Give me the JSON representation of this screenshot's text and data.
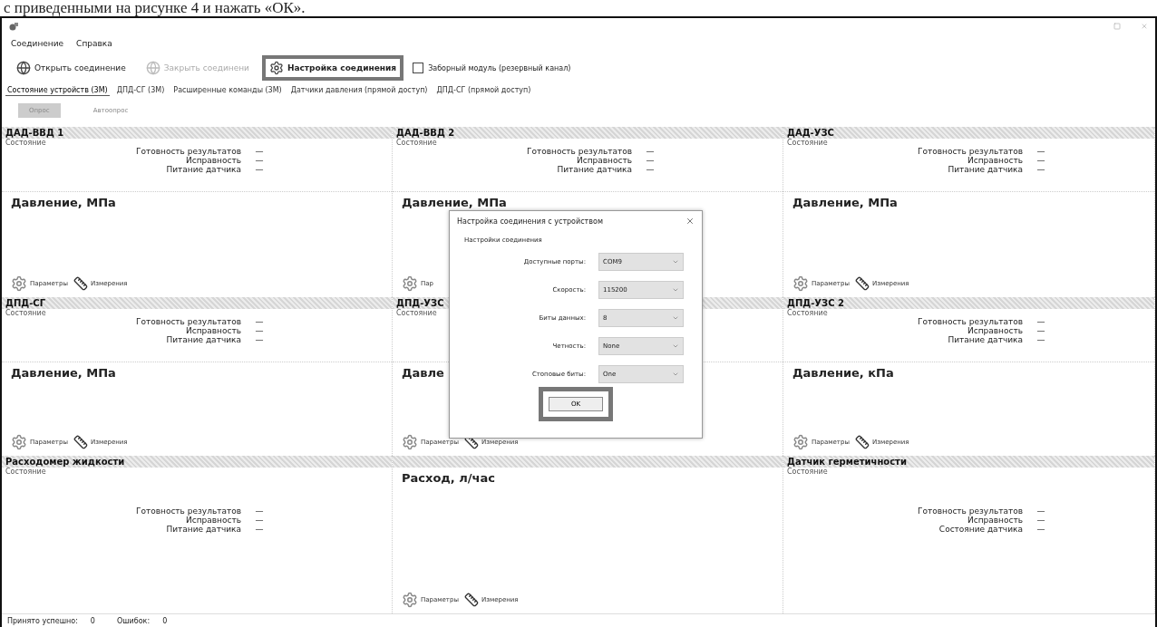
{
  "caption": "с приведенными на рисунке 4 и нажать «ОК».",
  "menu": [
    {
      "label": "Соединение"
    },
    {
      "label": "Справка"
    }
  ],
  "toolbar": [
    {
      "kind": "button",
      "label": "Открыть соединение",
      "disabled": false,
      "highlighted": false
    },
    {
      "kind": "button",
      "label": "Закрыть соединени",
      "disabled": true,
      "highlighted": false
    },
    {
      "kind": "button",
      "label": "Настройка соединения",
      "disabled": false,
      "highlighted": true
    },
    {
      "kind": "checkbox",
      "label": "Заборный модуль (резервный канал)",
      "checked": false
    }
  ],
  "tabs": [
    {
      "label": "Состояние устройств (3М)",
      "selected": true
    },
    {
      "label": "ДПД-СГ (3М)",
      "selected": false
    },
    {
      "label": "Расширенные команды (3М)",
      "selected": false
    },
    {
      "label": "Датчики давления (прямой доступ)",
      "selected": false
    },
    {
      "label": "ДПД-СГ (прямой доступ)",
      "selected": false
    }
  ],
  "poll_buttons": [
    {
      "label": "Опрос",
      "kind": "raised"
    },
    {
      "label": "Автоопрос",
      "kind": "flat"
    }
  ],
  "panels": [
    {
      "title": "ДАД-ВВД 1",
      "state_label": "Состояние",
      "status": [
        {
          "label": "Готовность результатов",
          "value": "—"
        },
        {
          "label": "Исправность",
          "value": "—"
        },
        {
          "label": "Питание датчика",
          "value": "—"
        }
      ],
      "measure": "Давление, МПа",
      "actions": [
        {
          "label": "Параметры",
          "kind": "gear"
        },
        {
          "label": "Измерения",
          "kind": "ruler"
        }
      ]
    },
    {
      "title": "ДАД-ВВД 2",
      "state_label": "Состояние",
      "status": [
        {
          "label": "Готовность результатов",
          "value": "—"
        },
        {
          "label": "Исправность",
          "value": "—"
        },
        {
          "label": "Питание датчика",
          "value": "—"
        }
      ],
      "measure": "Давление, МПа",
      "actions": [
        {
          "label": "Пар",
          "kind": "gear"
        }
      ]
    },
    {
      "title": "ДАД-УЗС",
      "state_label": "Состояние",
      "status": [
        {
          "label": "Готовность результатов",
          "value": "—"
        },
        {
          "label": "Исправность",
          "value": "—"
        },
        {
          "label": "Питание датчика",
          "value": "—"
        }
      ],
      "measure": "Давление, МПа",
      "actions": [
        {
          "label": "Параметры",
          "kind": "gear"
        },
        {
          "label": "Измерения",
          "kind": "ruler"
        }
      ]
    },
    {
      "title": "ДПД-СГ",
      "state_label": "Состояние",
      "status": [
        {
          "label": "Готовность результатов",
          "value": "—"
        },
        {
          "label": "Исправность",
          "value": "—"
        },
        {
          "label": "Питание датчика",
          "value": "—"
        }
      ],
      "measure": "Давление, МПа",
      "actions": [
        {
          "label": "Параметры",
          "kind": "gear"
        },
        {
          "label": "Измерения",
          "kind": "ruler"
        }
      ]
    },
    {
      "title": "ДПД-УЗС",
      "state_label": "Состояние",
      "measure": "Давле",
      "actions": [
        {
          "label": "Параметры",
          "kind": "gear"
        },
        {
          "label": "Измерения",
          "kind": "ruler"
        }
      ]
    },
    {
      "title": "ДПД-УЗС 2",
      "state_label": "Состояние",
      "status": [
        {
          "label": "Готовность результатов",
          "value": "—"
        },
        {
          "label": "Исправность",
          "value": "—"
        },
        {
          "label": "Питание датчика",
          "value": "—"
        }
      ],
      "measure": "Давление, кПа",
      "actions": [
        {
          "label": "Параметры",
          "kind": "gear"
        },
        {
          "label": "Измерения",
          "kind": "ruler"
        }
      ]
    },
    {
      "title": "Расходомер жидкости",
      "state_label": "Состояние",
      "status": [
        {
          "label": "Готовность результатов",
          "value": "—"
        },
        {
          "label": "Исправность",
          "value": "—"
        },
        {
          "label": "Питание датчика",
          "value": "—"
        }
      ]
    },
    {
      "measure": "Расход, л/час",
      "actions": [
        {
          "label": "Параметры",
          "kind": "gear"
        },
        {
          "label": "Измерения",
          "kind": "ruler"
        }
      ]
    },
    {
      "title": "Датчик герметичности",
      "state_label": "Состояние",
      "status": [
        {
          "label": "Готовность результатов",
          "value": "—"
        },
        {
          "label": "Исправность",
          "value": "—"
        },
        {
          "label": "Состояние датчика",
          "value": "—"
        }
      ]
    }
  ],
  "dialog": {
    "title": "Настройка соединения с устройством",
    "group_label": "Настройки соединения",
    "fields": [
      {
        "label": "Доступные порты:",
        "value": "COM9"
      },
      {
        "label": "Скорость:",
        "value": "115200"
      },
      {
        "label": "Биты данных:",
        "value": "8"
      },
      {
        "label": "Четность:",
        "value": "None"
      },
      {
        "label": "Стоповые биты:",
        "value": "One"
      }
    ],
    "ok_button": {
      "label": "OK",
      "highlighted": true
    }
  },
  "status_bar": [
    {
      "label": "Принято успешно:",
      "value": "0"
    },
    {
      "label": "Ошибок:",
      "value": "0"
    }
  ]
}
